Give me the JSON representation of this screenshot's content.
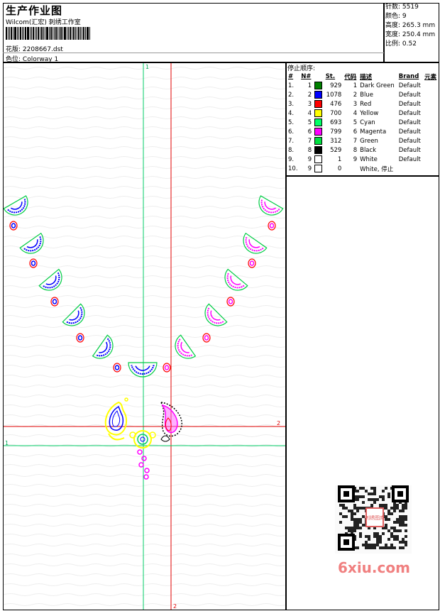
{
  "header": {
    "title": "生产作业图",
    "studio": "Wilcom(汇宏) 刺绣工作室",
    "design_label": "花版:",
    "design_file": "2208667.dst",
    "colorway_label": "色位:",
    "colorway": "Colorway 1"
  },
  "stats": [
    {
      "label": "针数:",
      "value": "5519"
    },
    {
      "label": "颜色:",
      "value": "9"
    },
    {
      "label": "高度:",
      "value": "265.3 mm"
    },
    {
      "label": "宽度:",
      "value": "250.4 mm"
    },
    {
      "label": "比例:",
      "value": "0.52"
    }
  ],
  "stop_sequence": {
    "title": "停止顺序:",
    "columns": [
      "#",
      "N#",
      "St.",
      "代码",
      "描述",
      "Brand",
      "元素"
    ],
    "rows": [
      {
        "idx": "1.",
        "n": "1",
        "color": "#008000",
        "st": "929",
        "code": "1",
        "desc": "Dark Green",
        "brand": "Default"
      },
      {
        "idx": "2.",
        "n": "2",
        "color": "#0000ff",
        "st": "1078",
        "code": "2",
        "desc": "Blue",
        "brand": "Default"
      },
      {
        "idx": "3.",
        "n": "3",
        "color": "#ff0000",
        "st": "476",
        "code": "3",
        "desc": "Red",
        "brand": "Default"
      },
      {
        "idx": "4.",
        "n": "4",
        "color": "#ffff00",
        "st": "700",
        "code": "4",
        "desc": "Yellow",
        "brand": "Default"
      },
      {
        "idx": "5.",
        "n": "5",
        "color": "#00ff66",
        "st": "693",
        "code": "5",
        "desc": "Cyan",
        "brand": "Default"
      },
      {
        "idx": "6.",
        "n": "6",
        "color": "#ff00ff",
        "st": "799",
        "code": "6",
        "desc": "Magenta",
        "brand": "Default"
      },
      {
        "idx": "7.",
        "n": "7",
        "color": "#00e040",
        "st": "312",
        "code": "7",
        "desc": "Green",
        "brand": "Default"
      },
      {
        "idx": "8.",
        "n": "8",
        "color": "#000000",
        "st": "529",
        "code": "8",
        "desc": "Black",
        "brand": "Default"
      },
      {
        "idx": "9.",
        "n": "9",
        "color": "#ffffff",
        "st": "1",
        "code": "9",
        "desc": "White",
        "brand": "Default"
      },
      {
        "idx": "10.",
        "n": "9",
        "color": "#ffffff",
        "st": "0",
        "code": "",
        "desc": "White, 停止",
        "brand": ""
      }
    ]
  },
  "guides": {
    "vertical_1": "1",
    "vertical_2": "2",
    "horizontal_1": "1",
    "horizontal_2": "2"
  },
  "watermark": "6xiu.com",
  "stamp_text": "刺绣图库"
}
